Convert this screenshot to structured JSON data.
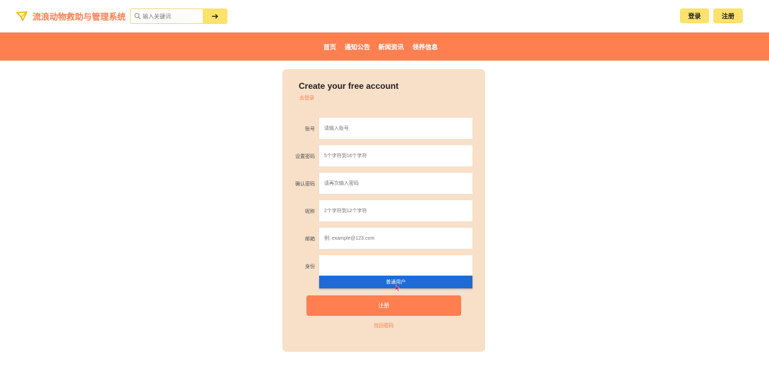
{
  "header": {
    "logo_icon": "paper-plane-icon",
    "site_title": "流浪动物救助与管理系统",
    "search": {
      "placeholder": "输入关键词",
      "search_icon": "search-icon",
      "button_icon": "arrow-right-icon",
      "button_glyph": "➔"
    },
    "login_label": "登录",
    "register_label": "注册"
  },
  "nav": {
    "items": [
      "首页",
      "通知公告",
      "新闻资讯",
      "领养信息"
    ]
  },
  "form": {
    "title": "Create your free account",
    "goto_login": "去登录",
    "fields": [
      {
        "label": "账号",
        "placeholder": "请输入账号"
      },
      {
        "label": "设置密码",
        "placeholder": "5个字符到16个字符"
      },
      {
        "label": "确认密码",
        "placeholder": "请再次输入密码"
      },
      {
        "label": "昵称",
        "placeholder": "2个字符到12个字符"
      },
      {
        "label": "邮箱",
        "placeholder": "例: example@123.com"
      },
      {
        "label": "身份",
        "placeholder": ""
      }
    ],
    "identity_option": "普通用户",
    "submit_label": "注册",
    "forgot_label": "找回密码"
  },
  "colors": {
    "accent": "#ff7f50",
    "button_yellow": "#ffe16b",
    "card_bg": "#f8dfc8",
    "dropdown_selected": "#1e6bd6"
  }
}
